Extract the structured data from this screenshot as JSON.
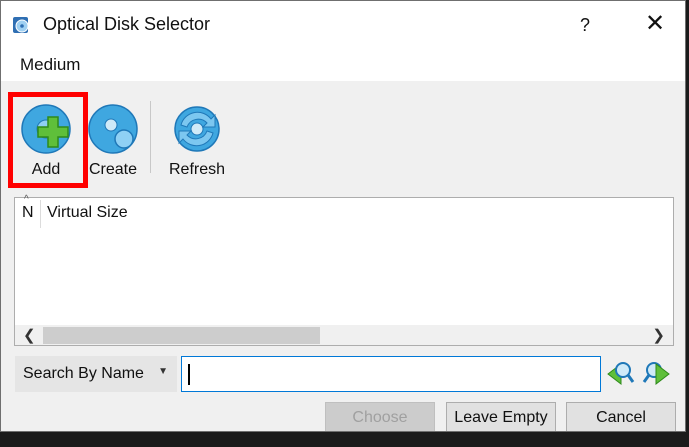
{
  "window": {
    "title": "Optical Disk Selector",
    "help_label": "?",
    "close_label": "✕"
  },
  "menu": {
    "items": [
      {
        "label": "Medium"
      }
    ]
  },
  "toolbar": {
    "add_label": "Add",
    "create_label": "Create",
    "refresh_label": "Refresh"
  },
  "list": {
    "columns": [
      {
        "label": "N"
      },
      {
        "label": "Virtual Size"
      }
    ],
    "rows": []
  },
  "search": {
    "mode": "Search By Name",
    "value": ""
  },
  "buttons": {
    "choose_label": "Choose",
    "leave_empty_label": "Leave Empty",
    "cancel_label": "Cancel"
  },
  "colors": {
    "highlight": "#ff0000",
    "focus_border": "#0078d7",
    "add_plus": "#5fbf3a",
    "disc_blue": "#3fa7e0"
  }
}
